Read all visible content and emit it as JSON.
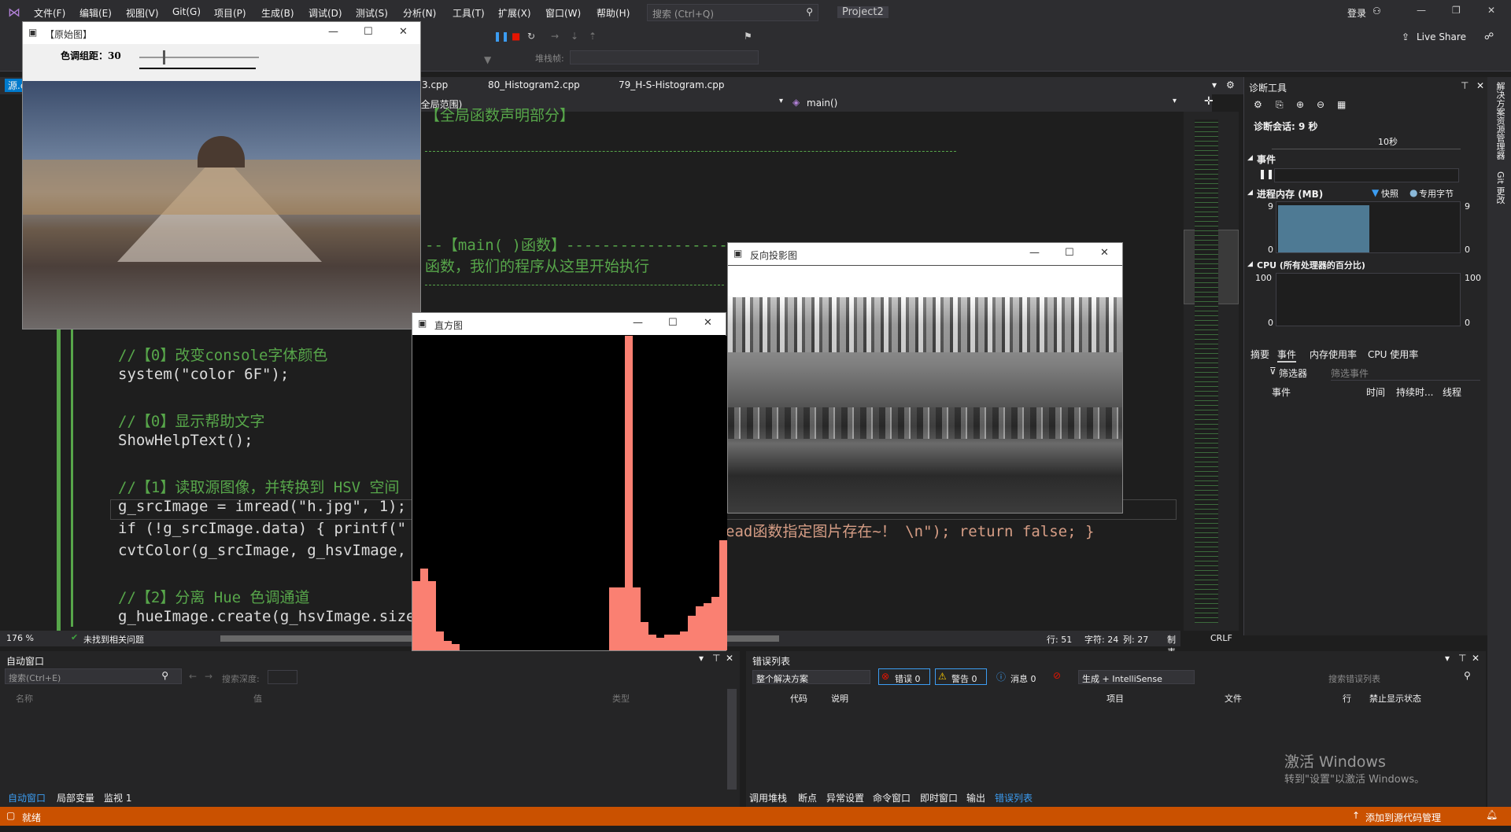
{
  "menubar": {
    "items": [
      "文件(F)",
      "编辑(E)",
      "视图(V)",
      "Git(G)",
      "项目(P)",
      "生成(B)",
      "调试(D)",
      "测试(S)",
      "分析(N)",
      "工具(T)",
      "扩展(X)",
      "窗口(W)",
      "帮助(H)"
    ],
    "search_placeholder": "搜索 (Ctrl+Q)",
    "project_name": "Project2",
    "login_label": "登录",
    "live_share_label": "Live Share"
  },
  "toolbar": {
    "stack_frame_label": "堆栈帧:"
  },
  "tabs": [
    "源.c",
    "3.cpp",
    "80_Histogram2.cpp",
    "79_H-S-Histogram.cpp"
  ],
  "navbar": {
    "scope": "(全局范围)",
    "function": "main()"
  },
  "code": {
    "line1": "【全局函数声明部分】",
    "line2": "--【main( )函数】------------------------------",
    "line3": "函数，我们的程序从这里开始执行",
    "c0": "//【0】改变console字体颜色",
    "c0b": "system(\"color 6F\");",
    "c1": "//【0】显示帮助文字",
    "c1b": "ShowHelpText();",
    "c2": "//【1】读取源图像，并转换到 HSV 空间",
    "c2b": "g_srcImage = imread(\"h.jpg\", 1);",
    "c2c": "if (!g_srcImage.data) { printf(\"",
    "c2c_tail": "ead函数指定图片存在~！ \\n\"); return false; }",
    "c2d": "cvtColor(g_srcImage, g_hsvImage,",
    "c3": "//【2】分离 Hue 色调通道",
    "c3b": "g_hueImage.create(g_hsvImage.size"
  },
  "editor_status": {
    "zoom": "176 %",
    "issues": "未找到相关问题",
    "line": "行: 51",
    "char": "字符: 24",
    "col": "列: 27",
    "tab": "制表符",
    "eol": "CRLF"
  },
  "diag": {
    "title": "诊断工具",
    "session": "诊断会话: 9 秒",
    "timeline_label": "10秒",
    "events_header": "事件",
    "memory_header": "进程内存 (MB)",
    "snapshot_legend": "快照",
    "private_bytes_legend": "专用字节",
    "mem_max": "9",
    "mem_min": "0",
    "cpu_header": "CPU (所有处理器的百分比)",
    "cpu_max": "100",
    "cpu_min": "0",
    "tabs": [
      "摘要",
      "事件",
      "内存使用率",
      "CPU 使用率"
    ],
    "filter_label": "筛选器",
    "filter_placeholder": "筛选事件",
    "cols": [
      "事件",
      "时间",
      "持续时...",
      "线程"
    ]
  },
  "right_strip": [
    "解决方案资源管理器",
    "Git 更改"
  ],
  "autos": {
    "title": "自动窗口",
    "search": "搜索(Ctrl+E)",
    "depth": "搜索深度:",
    "cols": [
      "名称",
      "值",
      "类型"
    ],
    "tabs": [
      "自动窗口",
      "局部变量",
      "监视 1"
    ]
  },
  "errors": {
    "title": "错误列表",
    "scope": "整个解决方案",
    "errors": "错误 0",
    "warnings": "警告 0",
    "messages": "消息 0",
    "build": "生成 + IntelliSense",
    "search": "搜索错误列表",
    "cols": [
      "代码",
      "说明",
      "项目",
      "文件",
      "行",
      "禁止显示状态"
    ],
    "tabs": [
      "调用堆栈",
      "断点",
      "异常设置",
      "命令窗口",
      "即时窗口",
      "输出",
      "错误列表"
    ],
    "activate1": "激活 Windows",
    "activate2": "转到\"设置\"以激活 Windows。"
  },
  "statusbar": {
    "ready": "就绪",
    "source_control": "添加到源代码管理"
  },
  "win_original": {
    "title": "【原始图】",
    "slider_label": "色调组距：30",
    "slider_value": 30
  },
  "win_histogram": {
    "title": "直方图",
    "bar_color": "#fa8072",
    "bins": [
      0.22,
      0.26,
      0.22,
      0.06,
      0.03,
      0.02,
      0.0,
      0.0,
      0.0,
      0.0,
      0.0,
      0.0,
      0.0,
      0.0,
      0.0,
      0.0,
      0.0,
      0.0,
      0.0,
      0.0,
      0.0,
      0.0,
      0.0,
      0.0,
      0.0,
      0.2,
      0.2,
      1.0,
      0.2,
      0.09,
      0.05,
      0.04,
      0.05,
      0.05,
      0.06,
      0.11,
      0.14,
      0.15,
      0.17,
      0.35
    ]
  },
  "win_backproj": {
    "title": "反向投影图"
  }
}
